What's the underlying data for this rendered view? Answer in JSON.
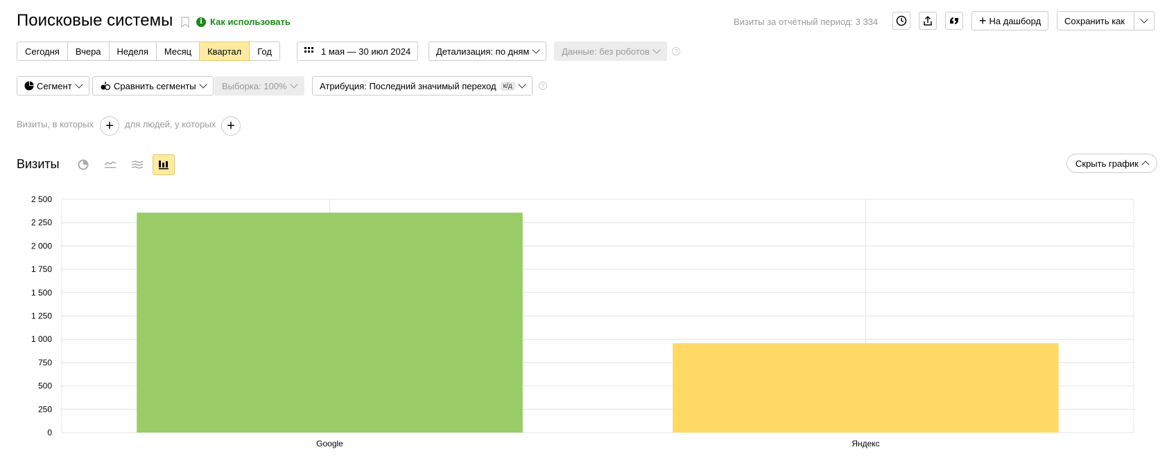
{
  "header": {
    "title": "Поисковые системы",
    "how_to_use": "Как использовать",
    "visits_total": "Визиты за отчётный период: 3 334",
    "dashboard_button": "На дашборд",
    "save_as_button": "Сохранить как"
  },
  "period": {
    "options": [
      "Сегодня",
      "Вчера",
      "Неделя",
      "Месяц",
      "Квартал",
      "Год"
    ],
    "active": "Квартал",
    "date_range": "1 мая — 30 июл 2024",
    "detail": "Детализация: по дням",
    "data_filter": "Данные: без роботов"
  },
  "segments": {
    "segment": "Сегмент",
    "compare": "Сравнить сегменты",
    "sample": "Выборка: 100%",
    "attribution": "Атрибуция: Последний значимый переход",
    "attribution_badge": "к/д"
  },
  "filters": {
    "visits_where": "Визиты, в которых",
    "people_where": "для людей, у которых"
  },
  "graph_section": {
    "title": "Визиты",
    "hide_button": "Скрыть график",
    "active_view": "bar"
  },
  "chart_data": {
    "type": "bar",
    "categories": [
      "Google",
      "Яндекс"
    ],
    "values": [
      2357,
      958
    ],
    "colors": [
      "#99cc66",
      "#ffd966"
    ],
    "ylim": [
      0,
      2500
    ],
    "yticks": [
      0,
      250,
      500,
      750,
      1000,
      1250,
      1500,
      1750,
      2000,
      2250,
      2500
    ],
    "ytick_labels": [
      "0",
      "250",
      "500",
      "750",
      "1 000",
      "1 250",
      "1 500",
      "1 750",
      "2 000",
      "2 250",
      "2 500"
    ],
    "grid": true
  },
  "colors": {
    "accent_yellow": "#ffeba0",
    "success_green": "#1a8a1a"
  }
}
